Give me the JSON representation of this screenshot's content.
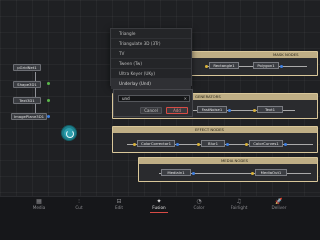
{
  "menu": {
    "items": [
      {
        "label": "Triangle"
      },
      {
        "label": "Triangulate 3D (3Tr)"
      },
      {
        "label": "TV"
      },
      {
        "label": "Tween (Tw)"
      },
      {
        "label": "Ultra Keyer (UKy)"
      },
      {
        "label": "Underlay (Und)"
      }
    ]
  },
  "dialog": {
    "value": "und",
    "clear_icon": "✕",
    "cancel_label": "Cancel",
    "add_label": "Add"
  },
  "left_nodes": [
    {
      "label": "pGridNet1"
    },
    {
      "label": "Shape3D1"
    },
    {
      "label": "Text3D1"
    },
    {
      "label": "ImagePlane3D1"
    }
  ],
  "groups": {
    "mask": {
      "title": "MASK NODES",
      "nodes": [
        {
          "label": "Rectangle1"
        },
        {
          "label": "Polygon1"
        }
      ]
    },
    "generator": {
      "title": "GENERATORS",
      "nodes": [
        {
          "label": "FastNoise1"
        },
        {
          "label": "Text1"
        }
      ]
    },
    "effect": {
      "title": "EFFECT NODES",
      "nodes": [
        {
          "label": "ColorCorrector1"
        },
        {
          "label": "Blur1"
        },
        {
          "label": "ColorCurves1"
        }
      ]
    },
    "media": {
      "title": "MEDIA NODES",
      "nodes": [
        {
          "label": "MediaIn1"
        },
        {
          "label": "MediaOut1"
        }
      ]
    }
  },
  "pages": [
    {
      "label": "Media",
      "icon": "media-icon",
      "glyph": "▦"
    },
    {
      "label": "Cut",
      "icon": "cut-icon",
      "glyph": "⫶"
    },
    {
      "label": "Edit",
      "icon": "edit-icon",
      "glyph": "⊟"
    },
    {
      "label": "Fusion",
      "icon": "fusion-icon",
      "glyph": "✦",
      "active": true
    },
    {
      "label": "Color",
      "icon": "color-icon",
      "glyph": "◔"
    },
    {
      "label": "Fairlight",
      "icon": "fairlight-icon",
      "glyph": "♫"
    },
    {
      "label": "Deliver",
      "icon": "deliver-icon",
      "glyph": "🚀"
    }
  ],
  "colors": {
    "accent": "#d74b45",
    "group_border": "#d9c79a",
    "output_port": "#3e7fe0",
    "input_port": "#d9b23a",
    "busy_cursor": "#2d9fae"
  }
}
